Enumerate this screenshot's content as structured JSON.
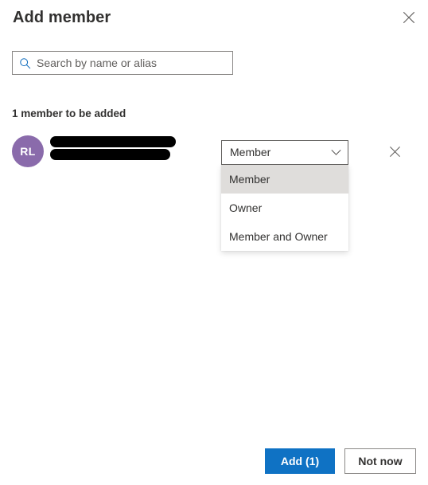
{
  "panel": {
    "title": "Add member",
    "close_icon": "close-icon"
  },
  "search": {
    "icon": "search-icon",
    "placeholder": "Search by name or alias",
    "value": ""
  },
  "list": {
    "count_label": "1 member to be added",
    "members": [
      {
        "initials": "RL",
        "avatar_color": "#8a6bab",
        "name_redacted": true,
        "secondary_redacted": true,
        "remove_icon": "close-icon",
        "role": {
          "selected": "Member",
          "caret_icon": "chevron-down-icon",
          "expanded": true,
          "options": [
            "Member",
            "Owner",
            "Member and Owner"
          ]
        }
      }
    ]
  },
  "footer": {
    "primary_label": "Add (1)",
    "secondary_label": "Not now"
  },
  "colors": {
    "accent": "#0f72c4",
    "search_icon": "#0f6cbd",
    "avatar": "#8a6bab",
    "option_highlight": "#dfdddb",
    "text": "#323130"
  }
}
